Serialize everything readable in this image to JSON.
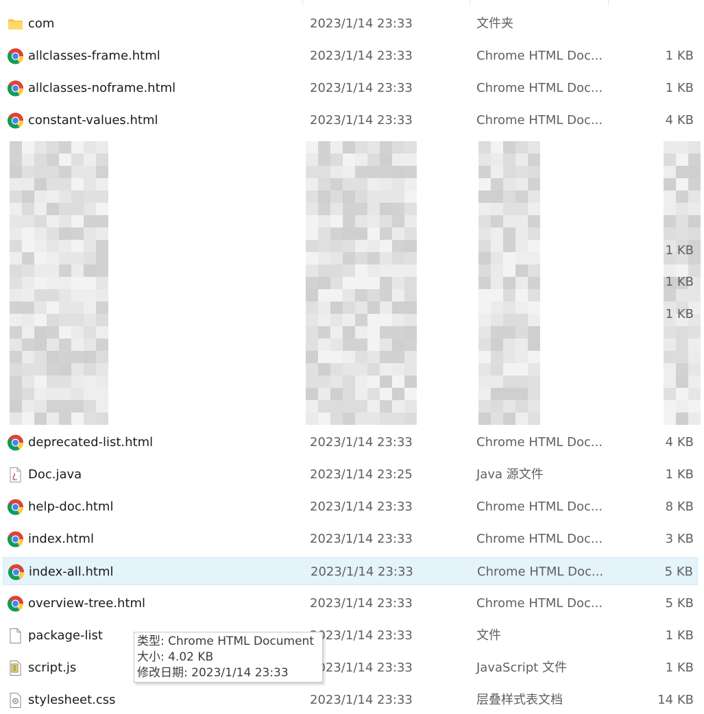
{
  "rows_top": [
    {
      "name": "com",
      "date": "2023/1/14 23:33",
      "type": "文件夹",
      "size": "",
      "icon": "folder-icon"
    },
    {
      "name": "allclasses-frame.html",
      "date": "2023/1/14 23:33",
      "type": "Chrome HTML Doc...",
      "size": "1 KB",
      "icon": "chrome-icon"
    },
    {
      "name": "allclasses-noframe.html",
      "date": "2023/1/14 23:33",
      "type": "Chrome HTML Doc...",
      "size": "1 KB",
      "icon": "chrome-icon"
    },
    {
      "name": "constant-values.html",
      "date": "2023/1/14 23:33",
      "type": "Chrome HTML Doc...",
      "size": "4 KB",
      "icon": "chrome-icon"
    }
  ],
  "blurred_visible_sizes": [
    "1 KB",
    "1 KB",
    "1 KB"
  ],
  "rows_bottom": [
    {
      "name": "deprecated-list.html",
      "date": "2023/1/14 23:33",
      "type": "Chrome HTML Doc...",
      "size": "4 KB",
      "icon": "chrome-icon",
      "selected": false
    },
    {
      "name": "Doc.java",
      "date": "2023/1/14 23:25",
      "type": "Java 源文件",
      "size": "1 KB",
      "icon": "java-file-icon",
      "selected": false
    },
    {
      "name": "help-doc.html",
      "date": "2023/1/14 23:33",
      "type": "Chrome HTML Doc...",
      "size": "8 KB",
      "icon": "chrome-icon",
      "selected": false
    },
    {
      "name": "index.html",
      "date": "2023/1/14 23:33",
      "type": "Chrome HTML Doc...",
      "size": "3 KB",
      "icon": "chrome-icon",
      "selected": false
    },
    {
      "name": "index-all.html",
      "date": "2023/1/14 23:33",
      "type": "Chrome HTML Doc...",
      "size": "5 KB",
      "icon": "chrome-icon",
      "selected": true
    },
    {
      "name": "overview-tree.html",
      "date": "2023/1/14 23:33",
      "type": "Chrome HTML Doc...",
      "size": "5 KB",
      "icon": "chrome-icon",
      "selected": false
    },
    {
      "name": "package-list",
      "date": "2023/1/14 23:33",
      "type": "文件",
      "size": "1 KB",
      "icon": "blank-file-icon",
      "selected": false
    },
    {
      "name": "script.js",
      "date": "2023/1/14 23:33",
      "type": "JavaScript 文件",
      "size": "1 KB",
      "icon": "script-file-icon",
      "selected": false
    },
    {
      "name": "stylesheet.css",
      "date": "2023/1/14 23:33",
      "type": "层叠样式表文档",
      "size": "14 KB",
      "icon": "css-file-icon",
      "selected": false
    }
  ],
  "tooltip": {
    "type_line": "类型: Chrome HTML Document",
    "size_line": "大小: 4.02 KB",
    "date_line": "修改日期: 2023/1/14 23:33"
  }
}
